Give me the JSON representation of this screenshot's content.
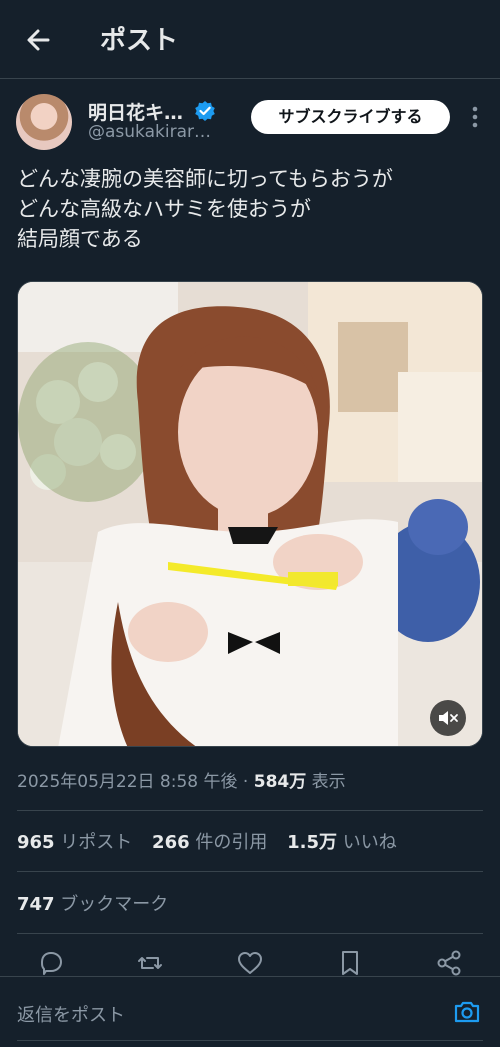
{
  "header": {
    "title": "ポスト"
  },
  "author": {
    "name": "明日花キ…",
    "handle": "@asukakirar…",
    "subscribe_label": "サブスクライブする"
  },
  "post": {
    "lines": [
      "どんな凄腕の美容師に切ってもらおうが",
      "どんな高級なハサミを使おうが",
      "結局顔である"
    ]
  },
  "meta": {
    "datetime": "2025年05月22日 8:58 午後",
    "separator": " · ",
    "views": "584万",
    "views_label": " 表示"
  },
  "stats": {
    "reposts": "965",
    "reposts_label": " リポスト",
    "quotes": "266",
    "quotes_label": " 件の引用",
    "likes": "1.5万",
    "likes_label": " いいね",
    "bookmarks": "747",
    "bookmarks_label": " ブックマーク"
  },
  "reply": {
    "placeholder": "返信をポスト"
  },
  "colors": {
    "background": "#15202b",
    "accent": "#1d9bf0",
    "muted": "#8b98a5",
    "divider": "#38444d"
  },
  "icons": [
    "back-arrow-icon",
    "verified-badge-icon",
    "more-icon",
    "mute-icon",
    "reply-icon",
    "repost-icon",
    "like-icon",
    "bookmark-icon",
    "share-icon",
    "camera-icon"
  ]
}
